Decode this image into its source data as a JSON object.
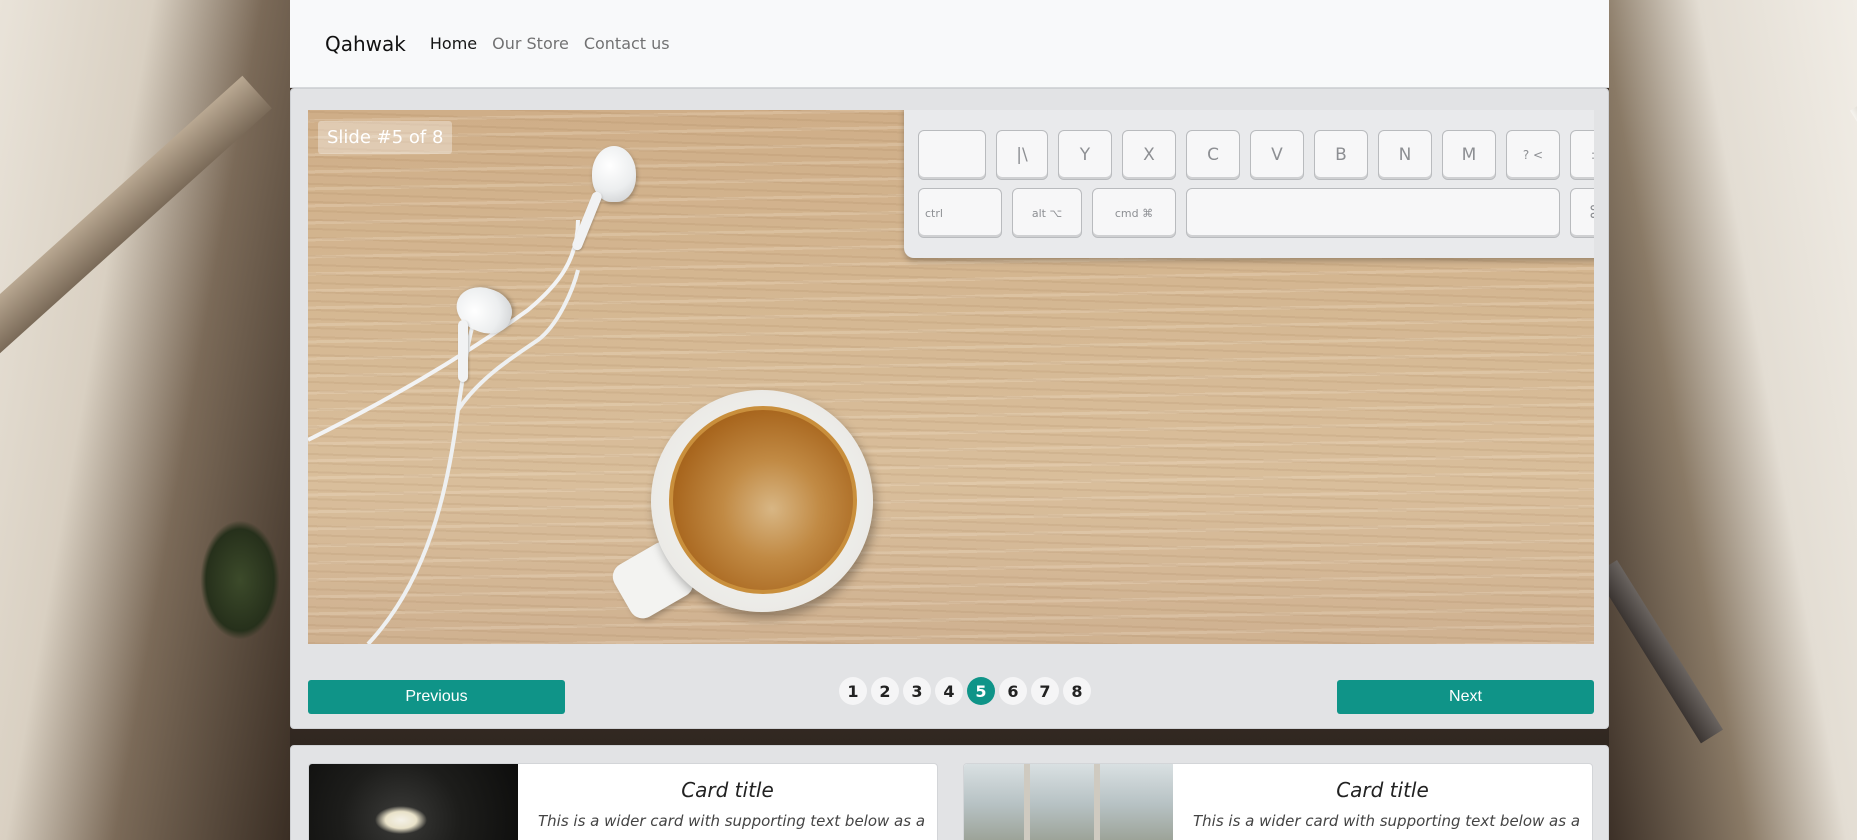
{
  "navbar": {
    "brand": "Qahwak",
    "links": [
      {
        "label": "Home",
        "active": true
      },
      {
        "label": "Our Store",
        "active": false
      },
      {
        "label": "Contact us",
        "active": false
      }
    ]
  },
  "carousel": {
    "slide_label": "Slide #5 of 8",
    "keyboard": {
      "row1": [
        "",
        "|\\",
        "Y",
        "X",
        "C",
        "V",
        "B",
        "N",
        "M",
        "? <",
        ": ;"
      ],
      "row2": [
        "ctrl",
        "alt ⌥",
        "cmd ⌘",
        "",
        "⌘"
      ]
    },
    "prev_label": "Previous",
    "next_label": "Next",
    "pages": [
      "1",
      "2",
      "3",
      "4",
      "5",
      "6",
      "7",
      "8"
    ],
    "current_page": "5"
  },
  "cards": [
    {
      "title": "Card title",
      "text": "This is a wider card with supporting text below as a"
    },
    {
      "title": "Card title",
      "text": "This is a wider card with supporting text below as a"
    }
  ],
  "colors": {
    "accent": "#0f9488",
    "navbar_bg": "#f8f9fa",
    "panel_bg": "#e2e3e5"
  }
}
